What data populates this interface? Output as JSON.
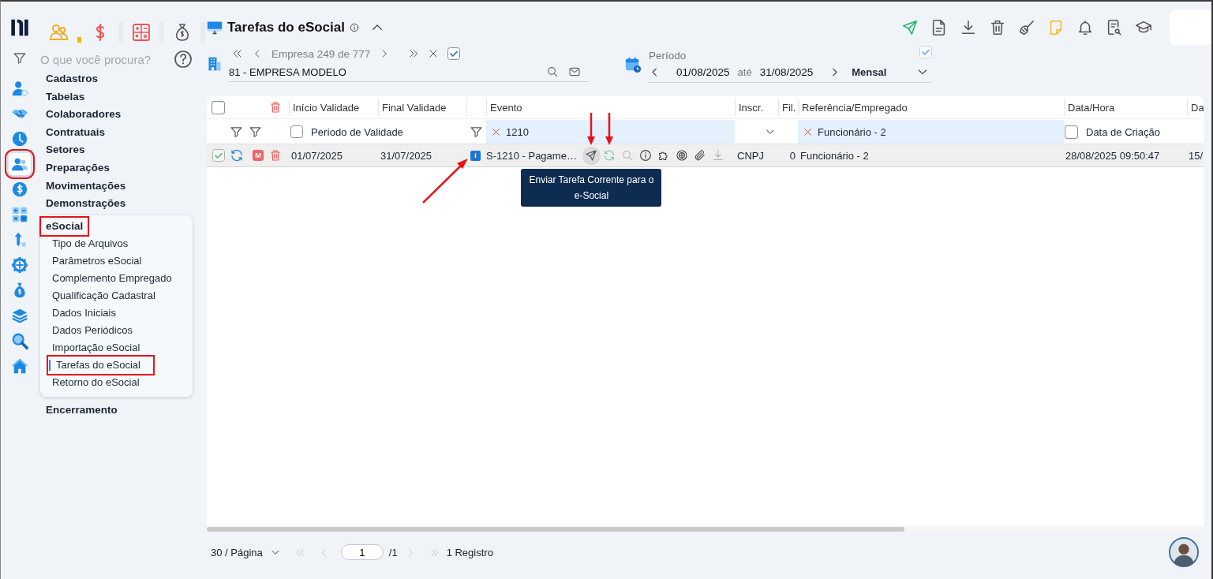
{
  "modules": [
    {
      "selected": true
    },
    {
      "selected": false
    },
    {
      "selected": false
    },
    {
      "selected": false
    }
  ],
  "rail": [
    {
      "selected": false,
      "highlighted": false
    },
    {
      "selected": false,
      "highlighted": false
    },
    {
      "selected": false,
      "highlighted": false
    },
    {
      "selected": true,
      "highlighted": true
    },
    {
      "selected": false,
      "highlighted": false
    },
    {
      "selected": false,
      "highlighted": false
    },
    {
      "selected": false,
      "highlighted": false
    },
    {
      "selected": false,
      "highlighted": false
    },
    {
      "selected": false,
      "highlighted": false
    },
    {
      "selected": false,
      "highlighted": false
    },
    {
      "selected": false,
      "highlighted": false
    },
    {
      "selected": false,
      "highlighted": false
    }
  ],
  "search": {
    "placeholder": "O que você procura?"
  },
  "menu": [
    {
      "label": "Cadastros",
      "expanded": false,
      "highlighted": false
    },
    {
      "label": "Tabelas",
      "expanded": false,
      "highlighted": false
    },
    {
      "label": "Colaboradores",
      "expanded": false,
      "highlighted": false
    },
    {
      "label": "Contratuais",
      "expanded": false,
      "highlighted": false
    },
    {
      "label": "Setores",
      "expanded": false,
      "highlighted": false
    },
    {
      "label": "Preparações",
      "expanded": false,
      "highlighted": false
    },
    {
      "label": "Movimentações",
      "expanded": false,
      "highlighted": false
    },
    {
      "label": "Demonstrações",
      "expanded": false,
      "highlighted": false
    },
    {
      "label": "eSocial",
      "expanded": true,
      "highlighted": true,
      "children": [
        {
          "label": "Tipo de Arquivos",
          "selected": false,
          "highlighted": false
        },
        {
          "label": "Parâmetros eSocial",
          "selected": false,
          "highlighted": false
        },
        {
          "label": "Complemento Empregado",
          "selected": false,
          "highlighted": false
        },
        {
          "label": "Qualificação Cadastral",
          "selected": false,
          "highlighted": false
        },
        {
          "label": "Dados Iniciais",
          "selected": false,
          "highlighted": false
        },
        {
          "label": "Dados Periódicos",
          "selected": false,
          "highlighted": false
        },
        {
          "label": "Importação eSocial",
          "selected": false,
          "highlighted": false
        },
        {
          "label": "Tarefas do eSocial",
          "selected": true,
          "highlighted": true
        },
        {
          "label": "Retorno do eSocial",
          "selected": false,
          "highlighted": false
        }
      ]
    },
    {
      "label": "Encerramento",
      "expanded": false,
      "highlighted": false
    }
  ],
  "header": {
    "title": "Tarefas do eSocial"
  },
  "company": {
    "position": "Empresa 249 de 777",
    "checked": true,
    "value": "81 - EMPRESA MODELO"
  },
  "period": {
    "label": "Período",
    "checked": true,
    "start": "01/08/2025",
    "separator": "até",
    "end": "31/08/2025",
    "frequency": "Mensal"
  },
  "grid": {
    "select_all": false,
    "columns": [
      "Início Validade",
      "Final Validade",
      "Evento",
      "Inscr.",
      "Fil.",
      "Referência/Empregado",
      "Data/Hora",
      "Da"
    ],
    "filters": {
      "validity_checked": false,
      "validity_label": "Período de Validade",
      "event": "1210",
      "reference": "Funcionário - 2",
      "created_checked": false,
      "created_label": "Data de Criação"
    },
    "rows": [
      {
        "checked": true,
        "flag": "M",
        "start": "01/07/2025",
        "end": "31/07/2025",
        "badge": "I",
        "badge_pointed": true,
        "event": "S-1210 - Pagame…",
        "actions": [
          {
            "pointed": true,
            "tooltip": "Enviar Tarefa Corrente para o e-Social"
          },
          {
            "pointed": true
          },
          {
            "pointed": false
          },
          {
            "pointed": false
          },
          {
            "pointed": false
          },
          {
            "pointed": false
          },
          {
            "pointed": false
          },
          {
            "pointed": false
          }
        ],
        "inscription": "CNPJ",
        "branch": "0",
        "reference": "Funcionário - 2",
        "datetime": "28/08/2025 09:50:47",
        "column_12": "15/"
      }
    ]
  },
  "pager": {
    "page_size": "30 / Página",
    "page": "1",
    "total_pages": "/1",
    "count": "1 Registro"
  }
}
